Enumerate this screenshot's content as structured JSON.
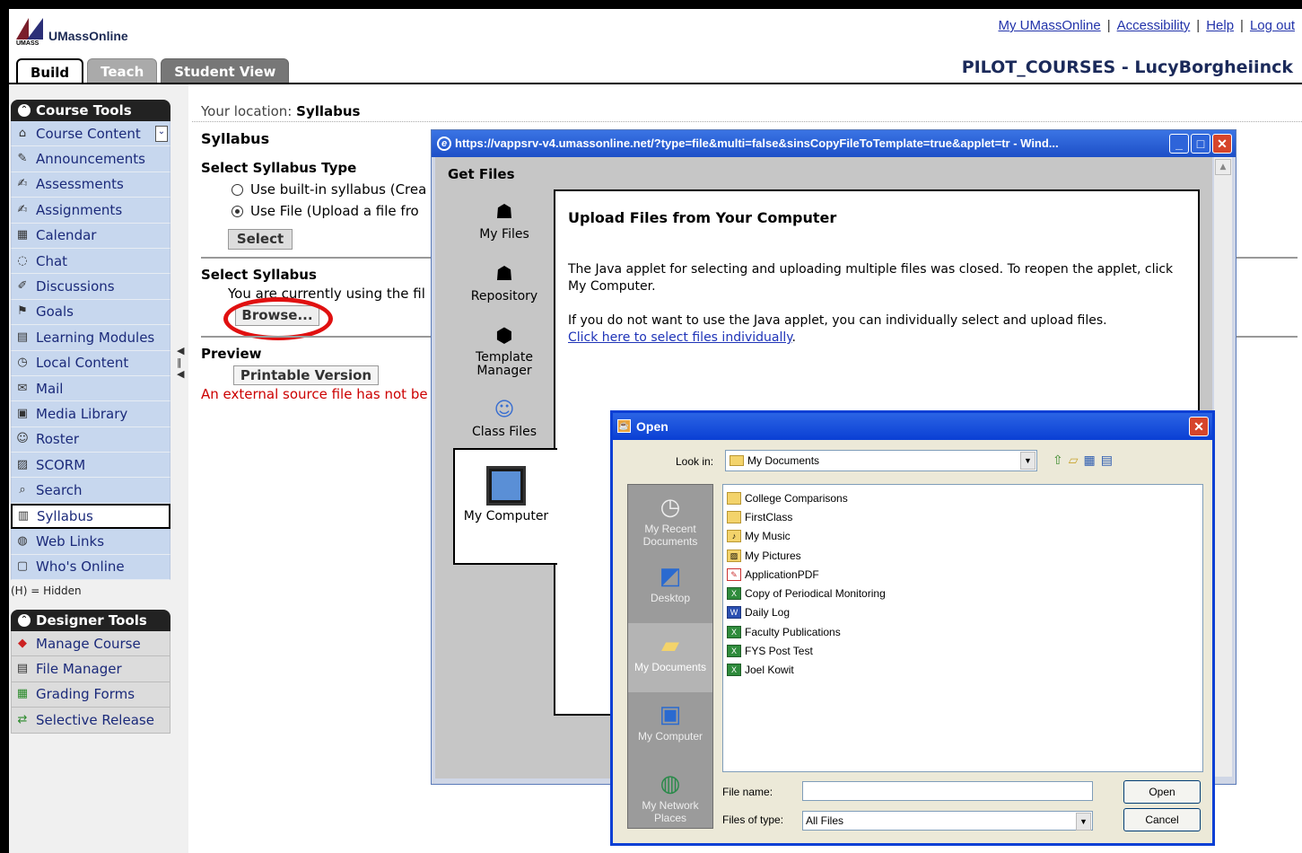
{
  "header": {
    "logo_text": "UMassOnline",
    "logo_small": "UMASS",
    "links": [
      "My UMassOnline",
      "Accessibility",
      "Help",
      "Log out"
    ],
    "course_title": "PILOT_COURSES - LucyBorgheiinck"
  },
  "tabs": [
    "Build",
    "Teach",
    "Student View"
  ],
  "course_tools": {
    "title": "Course Tools",
    "items": [
      "Course Content",
      "Announcements",
      "Assessments",
      "Assignments",
      "Calendar",
      "Chat",
      "Discussions",
      "Goals",
      "Learning Modules",
      "Local Content",
      "Mail",
      "Media Library",
      "Roster",
      "SCORM",
      "Search",
      "Syllabus",
      "Web Links",
      "Who's Online"
    ],
    "hidden_note": "(H) = Hidden"
  },
  "designer_tools": {
    "title": "Designer Tools",
    "items": [
      "Manage Course",
      "File Manager",
      "Grading Forms",
      "Selective Release"
    ]
  },
  "main": {
    "location_label": "Your location:",
    "location_value": "Syllabus",
    "heading": "Syllabus",
    "type_heading": "Select Syllabus Type",
    "radio_builtin": "Use built-in syllabus  (Crea",
    "radio_file": "Use File  (Upload a file fro",
    "select_button": "Select",
    "select_syllabus_heading": "Select Syllabus",
    "using_text": "You are currently using the fil",
    "browse_button": "Browse...",
    "preview_heading": "Preview",
    "printable_button": "Printable Version",
    "error_text": "An external source file has not be"
  },
  "get_files": {
    "window_title": "https://vappsrv-v4.umassonline.net/?type=file&multi=false&sinsCopyFileToTemplate=true&applet=tr - Wind...",
    "heading": "Get Files",
    "sources": [
      "My Files",
      "Repository",
      "Template Manager",
      "Class Files",
      "My Computer"
    ],
    "upload_heading": "Upload Files from Your Computer",
    "para1": "The Java applet for selecting and uploading multiple files was closed. To reopen the applet, click My Computer.",
    "para2": "If you do not want to use the Java applet, you can individually select and upload files.",
    "link": "Click here to select files individually",
    "link_suffix": "."
  },
  "open_dialog": {
    "title": "Open",
    "look_in_label": "Look in:",
    "look_in_value": "My Documents",
    "places": [
      "My Recent Documents",
      "Desktop",
      "My Documents",
      "My Computer",
      "My Network Places"
    ],
    "files": [
      {
        "name": "College Comparisons",
        "type": "folder"
      },
      {
        "name": "FirstClass",
        "type": "folder"
      },
      {
        "name": "My Music",
        "type": "folder"
      },
      {
        "name": "My Pictures",
        "type": "folder"
      },
      {
        "name": "ApplicationPDF",
        "type": "pdf"
      },
      {
        "name": "Copy of Periodical Monitoring",
        "type": "xls"
      },
      {
        "name": "Daily Log",
        "type": "doc"
      },
      {
        "name": "Faculty Publications",
        "type": "xls"
      },
      {
        "name": "FYS Post Test",
        "type": "xls"
      },
      {
        "name": "Joel Kowit",
        "type": "xls"
      }
    ],
    "file_name_label": "File name:",
    "file_name_value": "",
    "file_type_label": "Files of type:",
    "file_type_value": "All Files",
    "open_button": "Open",
    "cancel_button": "Cancel"
  }
}
